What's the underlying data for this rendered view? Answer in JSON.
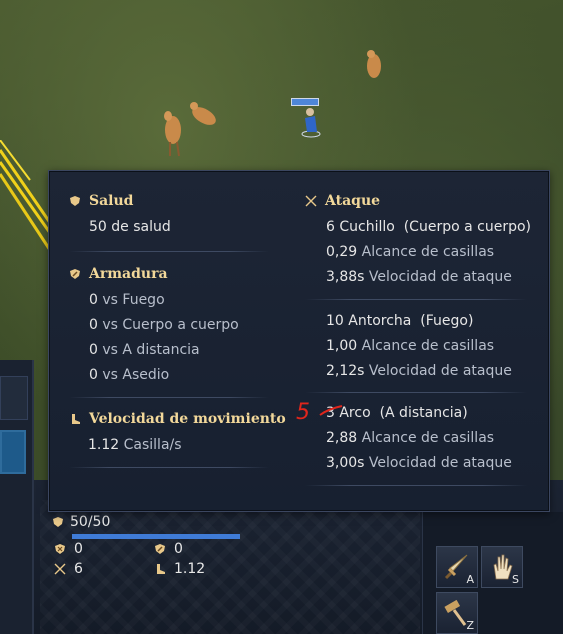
{
  "tooltip": {
    "health": {
      "title": "Salud",
      "value": "50 de salud",
      "icon": "heart-shield-icon"
    },
    "armor": {
      "title": "Armadura",
      "icon": "armor-shield-icon",
      "lines": [
        {
          "num": "0",
          "text": "vs Fuego"
        },
        {
          "num": "0",
          "text": "vs Cuerpo a cuerpo"
        },
        {
          "num": "0",
          "text": "vs A distancia"
        },
        {
          "num": "0",
          "text": "vs Asedio"
        }
      ]
    },
    "speed": {
      "title": "Velocidad de movimiento",
      "value": "1.12",
      "unit": "Casilla/s",
      "icon": "boot-icon"
    },
    "attack": {
      "title": "Ataque",
      "icon": "crossed-swords-icon",
      "weapons": [
        {
          "damage": "6 Cuchillo",
          "type": "(Cuerpo a cuerpo)",
          "range": "0,29",
          "range_label": "Alcance de casillas",
          "speed": "3,88s",
          "speed_label": "Velocidad de ataque"
        },
        {
          "damage": "10 Antorcha",
          "type": "(Fuego)",
          "range": "1,00",
          "range_label": "Alcance de casillas",
          "speed": "2,12s",
          "speed_label": "Velocidad de ataque"
        },
        {
          "damage": "3 Arco",
          "type": "(A distancia)",
          "range": "2,88",
          "range_label": "Alcance de casillas",
          "speed": "3,00s",
          "speed_label": "Velocidad de ataque"
        }
      ]
    },
    "annotation": "5"
  },
  "hud": {
    "hp_text": "50/50",
    "hp_fraction": 1.0,
    "armor_left": "0",
    "armor_right": "0",
    "attack": "6",
    "speed": "1.12",
    "abilities": [
      {
        "name": "attack-ability",
        "hotkey": "A",
        "icon": "sword-icon"
      },
      {
        "name": "stop-ability",
        "hotkey": "S",
        "icon": "hand-icon"
      },
      {
        "name": "build-ability",
        "hotkey": "Z",
        "icon": "hammer-icon"
      }
    ]
  },
  "colors": {
    "title_gold": "#f2d89a",
    "tooltip_bg": "#1d2535",
    "hp_blue": "#3f7bd6",
    "annotation_red": "#e0261c"
  }
}
